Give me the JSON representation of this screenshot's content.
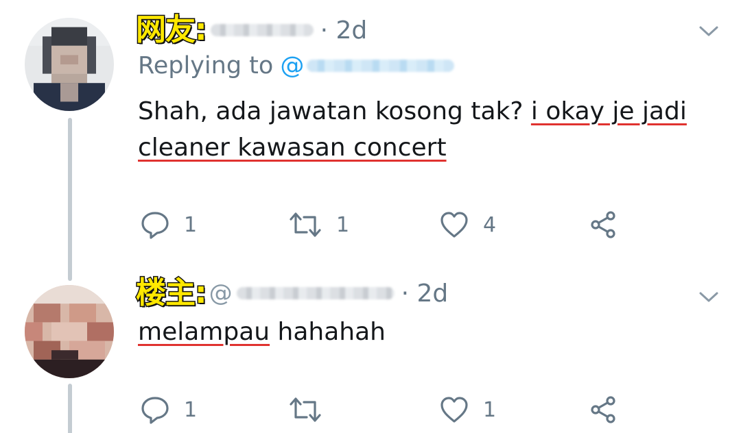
{
  "tweets": [
    {
      "tag": "网友:",
      "timestamp": "· 2d",
      "replying_label": "Replying to",
      "replying_at": "@",
      "text_plain": "Shah, ada jawatan kosong tak? ",
      "text_underlined_1": "i okay je jadi",
      "text_underlined_2": "cleaner kawasan concert",
      "reply_count": "1",
      "retweet_count": "1",
      "like_count": "4"
    },
    {
      "tag": "楼主:",
      "at_prefix": "@",
      "timestamp": "· 2d",
      "text_underlined": "melampau",
      "text_plain": " hahahah",
      "reply_count": "1",
      "retweet_count": "",
      "like_count": "1"
    }
  ],
  "colors": {
    "tag_yellow": "#ffe800",
    "underline_red": "#e0322f",
    "link_blue": "#1da1f2",
    "meta_gray": "#657786",
    "thread_line": "#c4ccd2"
  },
  "icons": [
    "reply-icon",
    "retweet-icon",
    "like-icon",
    "share-icon",
    "chevron-down-icon"
  ]
}
